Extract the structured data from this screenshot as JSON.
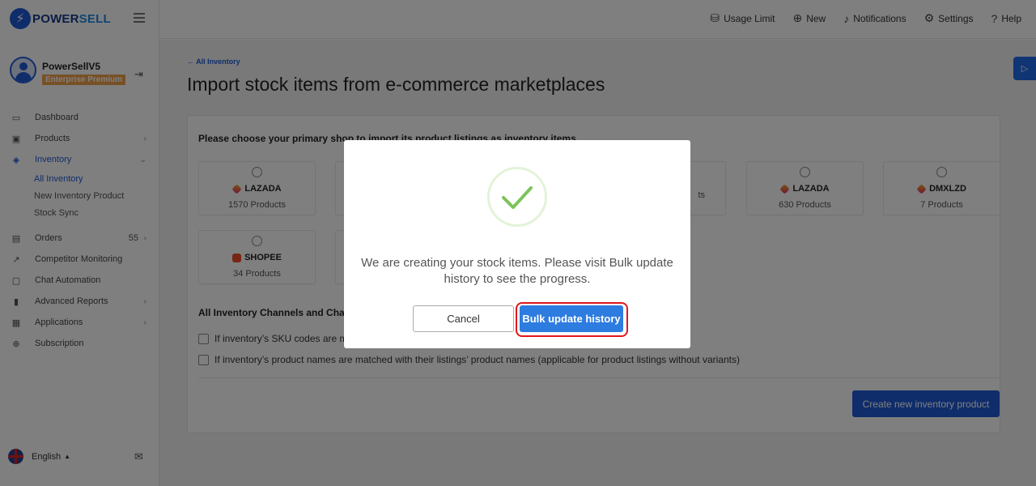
{
  "brand": {
    "name_a": "POWER",
    "name_b": "SELL"
  },
  "profile": {
    "name": "PowerSellV5",
    "plan": "Enterprise Premium"
  },
  "nav": {
    "dashboard": "Dashboard",
    "products": "Products",
    "inventory": "Inventory",
    "inventory_sub": [
      "All Inventory",
      "New Inventory Product",
      "Stock Sync"
    ],
    "orders": "Orders",
    "orders_count": "55",
    "competitor": "Competitor Monitoring",
    "chat": "Chat Automation",
    "reports": "Advanced Reports",
    "applications": "Applications",
    "subscription": "Subscription"
  },
  "language": "English",
  "topnav": {
    "usage": "Usage Limit",
    "new": "New",
    "notifications": "Notifications",
    "settings": "Settings",
    "help": "Help"
  },
  "page": {
    "breadcrumb": "← All Inventory",
    "title": "Import stock items from e-commerce marketplaces",
    "choose_label": "Please choose your primary shop to import its product listings as inventory items",
    "shops": [
      {
        "name": "LAZADA",
        "count": "1570 Products",
        "brand": "lazada"
      },
      {
        "name": "",
        "count": "",
        "brand": "lazada"
      },
      {
        "name": "",
        "count": "ts",
        "brand": "lazada"
      },
      {
        "name": "LAZADA",
        "count": "630 Products",
        "brand": "lazada"
      },
      {
        "name": "DMXLZD",
        "count": "7 Products",
        "brand": "lazada"
      },
      {
        "name": "SHOPEE",
        "count": "34 Products",
        "brand": "shopee"
      }
    ],
    "channels_title": "All Inventory Channels and Chan",
    "option_sku": "If inventory’s SKU codes are m",
    "option_names": "If inventory’s product names are matched with their listings’ product names (applicable for product listings without variants)",
    "create_button": "Create new inventory product"
  },
  "modal": {
    "message": "We are creating your stock items. Please visit Bulk update history to see the progress.",
    "cancel": "Cancel",
    "confirm": "Bulk update history"
  },
  "colors": {
    "accent": "#1e5bd6",
    "highlight": "#e0161b",
    "success": "#7cc35a"
  }
}
